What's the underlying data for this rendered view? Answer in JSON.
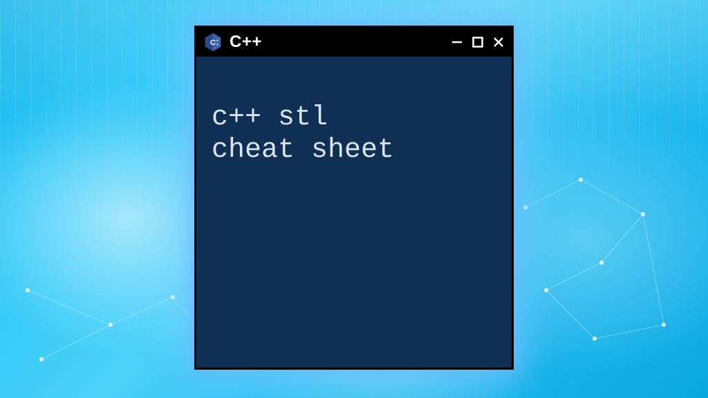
{
  "window": {
    "title": "C++",
    "icon": "cpp-hex-icon"
  },
  "content": {
    "text": "c++ stl\ncheat sheet"
  },
  "colors": {
    "titlebar_bg": "#000000",
    "body_bg": "#0f2f55",
    "body_fg": "#d9e6ee",
    "glow": "#5fc7ff"
  }
}
